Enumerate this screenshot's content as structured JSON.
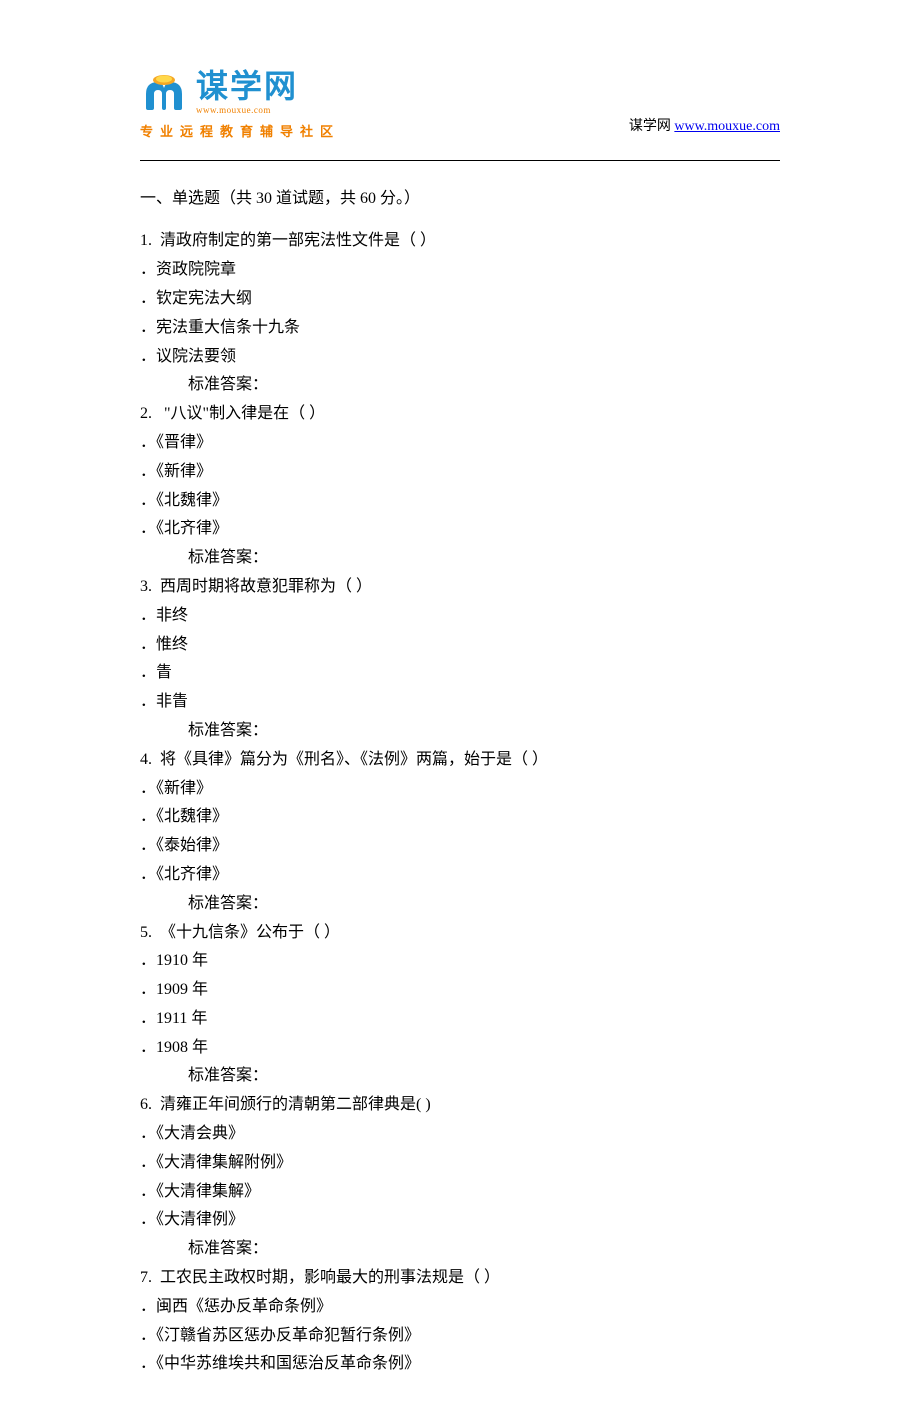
{
  "header": {
    "logo_cn": "谋学网",
    "logo_url": "www.mouxue.com",
    "tagline": "专业远程教育辅导社区",
    "right_prefix": "谋学网",
    "right_link": "www.mouxue.com"
  },
  "section": {
    "title": "一、单选题（共 30 道试题，共 60 分。）"
  },
  "questions": [
    {
      "num": "1.",
      "text": "清政府制定的第一部宪法性文件是（ ）",
      "options": [
        "资政院院章",
        "钦定宪法大纲",
        "宪法重大信条十九条",
        "议院法要领"
      ],
      "answer": "标准答案："
    },
    {
      "num": "2.",
      "text": " \"八议\"制入律是在（ ）",
      "options": [
        "《晋律》",
        "《新律》",
        "《北魏律》",
        "《北齐律》"
      ],
      "answer": "标准答案："
    },
    {
      "num": "3.",
      "text": "西周时期将故意犯罪称为（ ）",
      "options": [
        "非终",
        "惟终",
        "眚",
        "非眚"
      ],
      "answer": "标准答案："
    },
    {
      "num": "4.",
      "text": "将《具律》篇分为《刑名》、《法例》两篇，始于是（ ）",
      "options": [
        "《新律》",
        "《北魏律》",
        "《泰始律》",
        "《北齐律》"
      ],
      "answer": "标准答案："
    },
    {
      "num": "5.",
      "text": "《十九信条》公布于（ ）",
      "options": [
        "1910 年",
        "1909 年",
        "1911 年",
        "1908 年"
      ],
      "answer": "标准答案："
    },
    {
      "num": "6.",
      "text": "清雍正年间颁行的清朝第二部律典是( )",
      "options": [
        "《大清会典》",
        "《大清律集解附例》",
        "《大清律集解》",
        "《大清律例》"
      ],
      "answer": "标准答案："
    },
    {
      "num": "7.",
      "text": "工农民主政权时期，影响最大的刑事法规是（ ）",
      "options": [
        "闽西《惩办反革命条例》",
        "《汀赣省苏区惩办反革命犯暂行条例》",
        "《中华苏维埃共和国惩治反革命条例》"
      ],
      "answer": null
    }
  ]
}
